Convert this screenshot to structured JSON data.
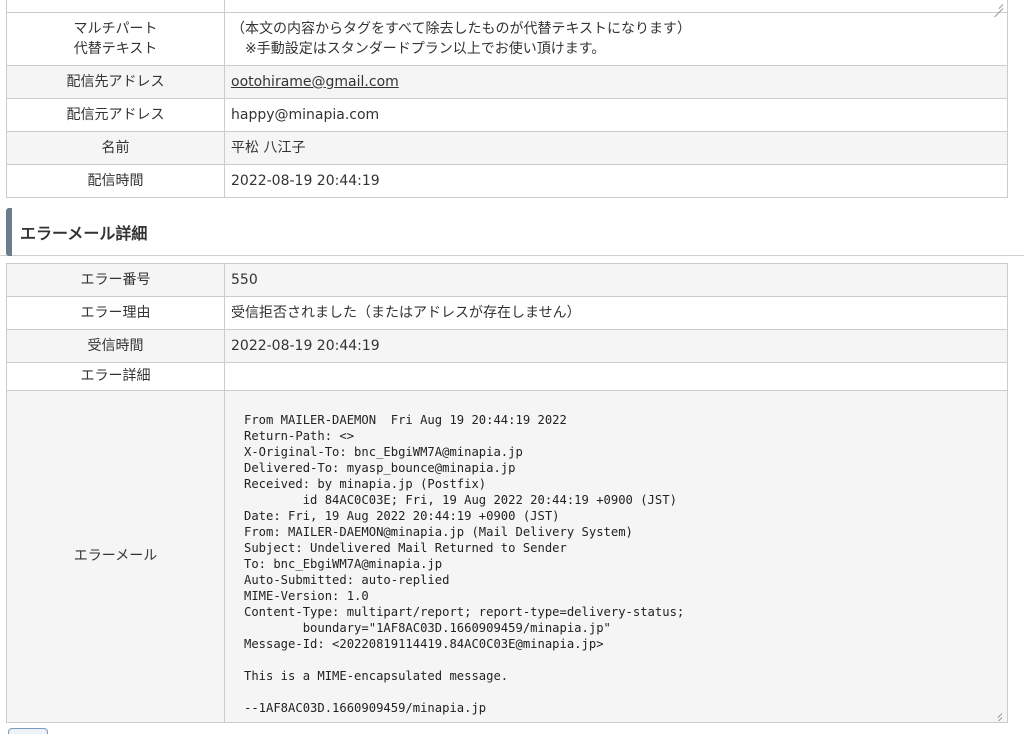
{
  "mail_info": {
    "multipart_label": "マルチパート\n代替テキスト",
    "multipart_line1": "（本文の内容からタグをすべて除去したものが代替テキストになります）",
    "multipart_line2": "※手動設定はスタンダードプラン以上でお使い頂けます。",
    "to_label": "配信先アドレス",
    "to_value": "ootohirame@gmail.com",
    "from_label": "配信元アドレス",
    "from_value": "happy@minapia.com",
    "name_label": "名前",
    "name_value": "平松 八江子",
    "time_label": "配信時間",
    "time_value": "2022-08-19 20:44:19"
  },
  "section": {
    "title": "エラーメール詳細"
  },
  "error_info": {
    "code_label": "エラー番号",
    "code_value": "550",
    "reason_label": "エラー理由",
    "reason_value": "受信拒否されました（またはアドレスが存在しません）",
    "received_label": "受信時間",
    "received_value": "2022-08-19 20:44:19",
    "detail_label": "エラー詳細",
    "detail_value": "",
    "mail_label": "エラーメール",
    "mail_body": "From MAILER-DAEMON  Fri Aug 19 20:44:19 2022\nReturn-Path: <>\nX-Original-To: bnc_EbgiWM7A@minapia.jp\nDelivered-To: myasp_bounce@minapia.jp\nReceived: by minapia.jp (Postfix)\n        id 84AC0C03E; Fri, 19 Aug 2022 20:44:19 +0900 (JST)\nDate: Fri, 19 Aug 2022 20:44:19 +0900 (JST)\nFrom: MAILER-DAEMON@minapia.jp (Mail Delivery System)\nSubject: Undelivered Mail Returned to Sender\nTo: bnc_EbgiWM7A@minapia.jp\nAuto-Submitted: auto-replied\nMIME-Version: 1.0\nContent-Type: multipart/report; report-type=delivery-status;\n        boundary=\"1AF8AC03D.1660909459/minapia.jp\"\nMessage-Id: <20220819114419.84AC0C03E@minapia.jp>\n\nThis is a MIME-encapsulated message.\n\n--1AF8AC03D.1660909459/minapia.jp"
  }
}
